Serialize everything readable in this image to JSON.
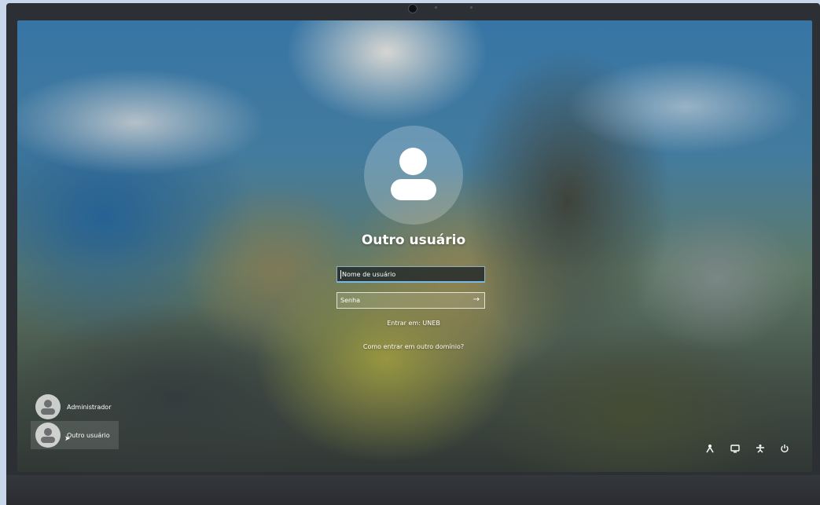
{
  "login": {
    "user_title": "Outro usuário",
    "username_placeholder": "Nome de usuário",
    "password_placeholder": "Senha",
    "domain_text": "Entrar em: UNEB",
    "other_domain_link": "Como entrar em outro domínio?"
  },
  "accounts": [
    {
      "name": "Administrador",
      "selected": false
    },
    {
      "name": "Outro usuário",
      "selected": true
    }
  ],
  "tray": {
    "accessibility_icon": "accessibility-icon",
    "network_icon": "network-icon",
    "ease_icon": "ease-of-access-icon",
    "power_icon": "power-icon"
  },
  "colors": {
    "field_focus_underline": "#7ab8e8",
    "bezel": "#2c2f33"
  }
}
